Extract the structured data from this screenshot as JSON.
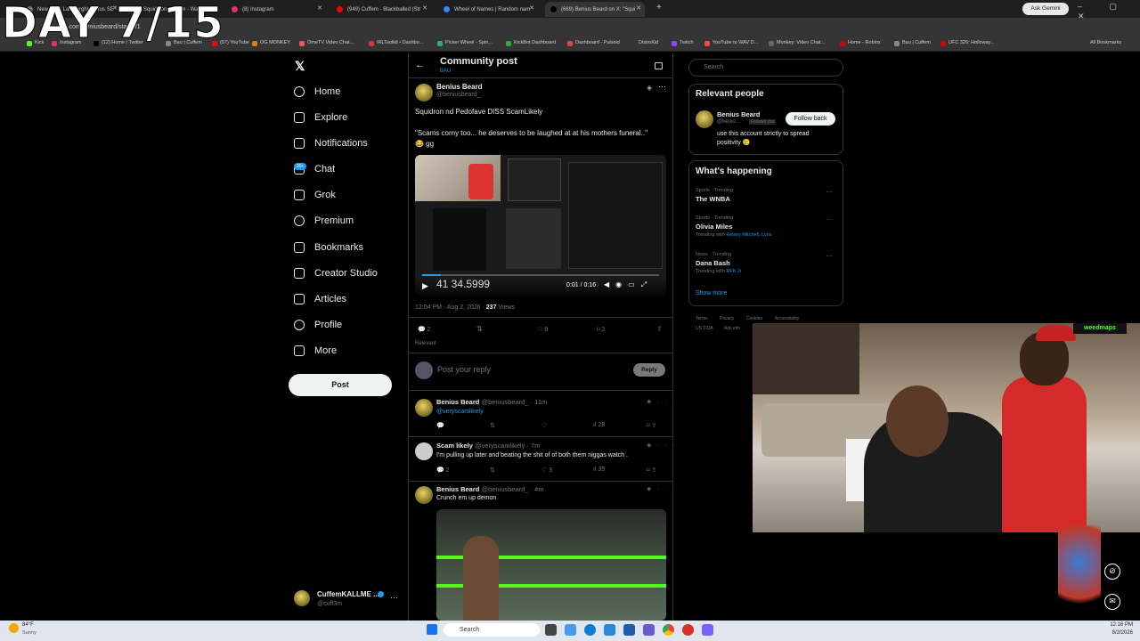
{
  "overlay": {
    "day_text": "DAY 7/15"
  },
  "browser": {
    "tabs": [
      {
        "label": "New 2026 Lamborghini Urus SE",
        "color": "#777"
      },
      {
        "label": "SquidRon Stream - Watch Live",
        "color": "#53fc18"
      },
      {
        "label": "(8) Instagram",
        "color": "#e1306c"
      },
      {
        "label": "(949) Cuffem - Blackballed (Str",
        "color": "#ff0000"
      },
      {
        "label": "Wheel of Names | Random nam",
        "color": "#3b82f6"
      },
      {
        "label": "(669) Benius Beard on X: \"Squi",
        "color": "#000"
      }
    ],
    "ask_gemini": "Ask Gemini",
    "url": "x.com/beniusbeard/status/1",
    "bookmarks": [
      "Kick",
      "Instagram",
      "(12) Home / Twitter",
      "Bau | Cuffem",
      "(57) YouTube",
      "OG MONKEY",
      "OmeTV Video Chat...",
      "IRLToolkit • Dashbo...",
      "Picker Wheel - Spin...",
      "KickBot Dashboard",
      "Dashboard - Pulsoid",
      "DistroKid",
      "Twitch",
      "YouTube to WAV D...",
      "Monkey: Video Chat...",
      "Home - Roblox",
      "Bau | Cuffem",
      "UFC 326: Holloway..."
    ],
    "all_bookmarks": "All Bookmarks"
  },
  "nav": {
    "items": [
      "Home",
      "Explore",
      "Notifications",
      "Chat",
      "Grok",
      "Premium",
      "Bookmarks",
      "Creator Studio",
      "Articles",
      "Profile",
      "More"
    ],
    "chat_badge": "20+",
    "post_label": "Post",
    "account_name": "CuffemKALLME ...",
    "account_handle": "@cuff3m"
  },
  "header": {
    "title": "Community post",
    "subtitle": "BAU"
  },
  "post": {
    "author": "Benius Beard",
    "handle": "@beniusbeard_",
    "text1": "Squidron nd Pedofave DISS ScamLikely",
    "text2": "\"Scams corny too... he deserves to be laughed at at his mothers funeral..\"",
    "text3": "😂 gg",
    "video_time": "0:01 / 0:16",
    "video_overlay": "41   34.5999",
    "timestamp": "12:04 PM · Aug 2, 2026 · ",
    "views_num": "237",
    "views_label": " Views",
    "replies": "2",
    "likes": "9",
    "bookmarks": "2",
    "sort": "Relevant",
    "reply_placeholder": "Post your reply",
    "reply_button": "Reply"
  },
  "replies": [
    {
      "author": "Benius Beard",
      "handle": "@beniusbeard_ · 11m",
      "text": "@veryscamlikely",
      "views": "28"
    },
    {
      "author": "Scam likely",
      "handle": "@veryscamlikely · 7m",
      "text": "I'm pulling up later and beating the shit of of both them niggas watch .",
      "replies": "2",
      "likes": "3",
      "views": "35"
    },
    {
      "author": "Benius Beard",
      "handle": "@beniusbeard_ · 4m",
      "text": "Crunch em up demon"
    }
  ],
  "right": {
    "search_placeholder": "Search",
    "relevant_title": "Relevant people",
    "rp_name": "Benius Beard",
    "rp_handle": "@beniu...",
    "rp_follows": "Follows you",
    "rp_button": "Follow back",
    "rp_bio": "use this account strictly to spread positivity 🥲",
    "happening_title": "What's happening",
    "trends": [
      {
        "meta": "Sports · Trending",
        "name": "The WNBA",
        "with": ""
      },
      {
        "meta": "Sports · Trending",
        "name": "Olivia Miles",
        "with_prefix": "Trending with ",
        "with": "Kelsey Mitchell, Lynx"
      },
      {
        "meta": "News · Trending",
        "name": "Dana Bash",
        "with_prefix": "Trending with ",
        "with": "RFK Jr"
      }
    ],
    "show_more": "Show more",
    "footer": [
      "Terms",
      "Privacy",
      "Cookies",
      "Accessibility",
      "US TIDA",
      "Ads info"
    ]
  },
  "taskbar": {
    "weather_temp": "84°F",
    "weather_cond": "Sunny",
    "search": "Search",
    "time": "12:16 PM",
    "date": "8/2/2026"
  }
}
